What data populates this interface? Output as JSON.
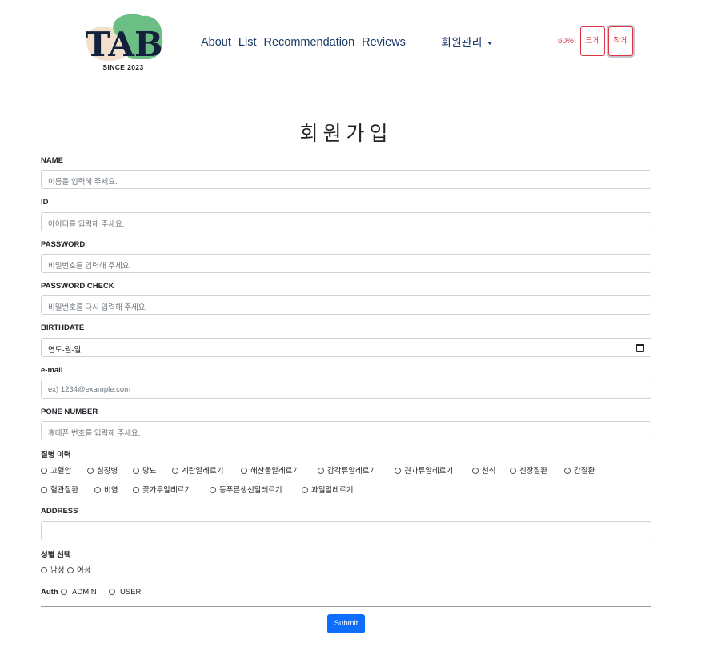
{
  "header": {
    "logo": {
      "text": "TAB",
      "since": "SINCE 2023"
    },
    "nav": [
      "About",
      "List",
      "Recommendation",
      "Reviews"
    ],
    "member_menu": "회원관리",
    "font_size": {
      "zoom": "60%",
      "bigger": "크게",
      "smaller": "작게"
    }
  },
  "title": "회원가입",
  "form": {
    "name": {
      "label": "NAME",
      "placeholder": "이름을 입력해 주세요."
    },
    "id": {
      "label": "ID",
      "placeholder": "아이디를 입력해 주세요."
    },
    "password": {
      "label": "PASSWORD",
      "placeholder": "비밀번호를 입력해 주세요."
    },
    "password_check": {
      "label": "PASSWORD CHECK",
      "placeholder": "비밀번호를 다시 입력해 주세요."
    },
    "birthdate": {
      "label": "BIRTHDATE",
      "placeholder": "연도-월-일"
    },
    "email": {
      "label": "e-mail",
      "placeholder": "ex) 1234@example.com"
    },
    "phone": {
      "label": "PONE NUMBER",
      "placeholder": "휴대폰 번호를 입력해 주세요."
    },
    "disease": {
      "label": "질병 이력",
      "options": [
        "고혈압",
        "심장병",
        "당뇨",
        "계란알레르기",
        "해산물알레르기",
        "갑각류알레르기",
        "견과류알레르기",
        "천식",
        "신장질환",
        "간질환",
        "혈관질환",
        "비염",
        "꽃가루알레르기",
        "등푸른생선알레르기",
        "과일알레르기"
      ]
    },
    "address": {
      "label": "ADDRESS",
      "value": ""
    },
    "gender": {
      "label": "성별 선택",
      "options": [
        "남성",
        "여성"
      ]
    },
    "auth": {
      "label": "Auth",
      "options": [
        "ADMIN",
        "USER"
      ]
    },
    "submit": "Submit"
  },
  "colors": {
    "nav_text": "#1a3a68",
    "accent_red": "#dc3545",
    "submit_bg": "#0d6efd"
  }
}
